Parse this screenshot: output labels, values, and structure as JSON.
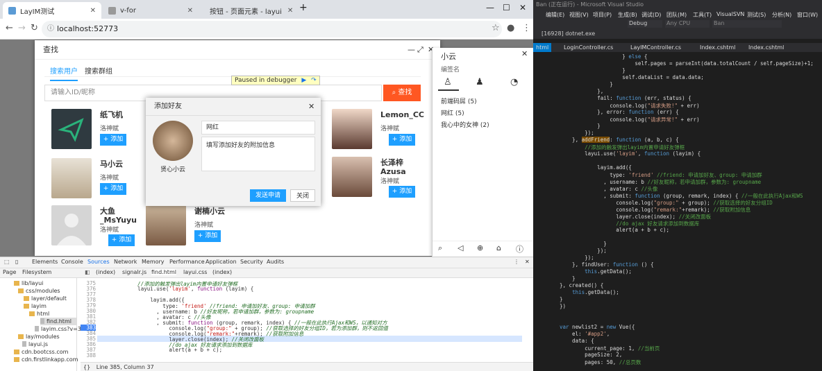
{
  "browser": {
    "tabs": [
      {
        "label": "LayIM测试",
        "icon_color": "#5b9bd5"
      },
      {
        "label": "v-for",
        "icon_color": "#999999"
      },
      {
        "label": "按钮 - 页面元素 - layui",
        "icon_color": "#393d49"
      }
    ],
    "new_tab": "+",
    "url": "localhost:52773",
    "debugger_label": "Paused in debugger"
  },
  "find_dialog": {
    "title": "查找",
    "tabs": [
      "搜索用户",
      "搜索群组"
    ],
    "search_placeholder": "请输入ID/昵称",
    "search_button": "查找",
    "add_label": "+ 添加",
    "users": [
      {
        "name": "纸飞机",
        "sign": "洛神赋"
      },
      {
        "name": "马小云",
        "sign": "洛神赋"
      },
      {
        "name": "大鱼_MsYuyu",
        "sign": "洛神赋"
      },
      {
        "name": "谢楠小云",
        "sign": "洛神赋"
      },
      {
        "name": "Lemon_CC",
        "sign": "洛神赋"
      },
      {
        "name": "长泽梓Azusa",
        "sign": "洛神赋"
      }
    ]
  },
  "add_friend": {
    "title": "添加好友",
    "avatar_name": "贤心小云",
    "remark_value": "网红",
    "remark_text": "填写添加好友的附加信息",
    "send_button": "发送申请",
    "close_button": "关闭"
  },
  "chat_panel": {
    "title": "小云",
    "subtitle": "编签名",
    "groups": [
      "前端码屌 (5)",
      "网红 (5)",
      "我心中的女神 (2)"
    ]
  },
  "devtools": {
    "tabs": [
      "Elements",
      "Console",
      "Sources",
      "Network",
      "Memory",
      "Performance",
      "Application",
      "Security",
      "Audits"
    ],
    "source_tabs": [
      "(index)",
      "signalr.js",
      "find.html",
      "layui.css",
      "(index)"
    ],
    "left_tabs": [
      "Page",
      "Filesystem"
    ],
    "tree": [
      "lib/layui",
      "css/modules",
      "layer/default",
      "layim",
      "html",
      "find.html",
      "layim.css?v=3",
      "lay/modules",
      "layui.js",
      "cdn.bootcss.com",
      "cdn.firstlinkapp.com"
    ],
    "line_numbers": [
      "375",
      "376",
      "377",
      "378",
      "379",
      "380",
      "381",
      "382",
      "383",
      "384",
      "385",
      "386",
      "387",
      "388"
    ],
    "status": "Line 385, Column 37"
  },
  "vs": {
    "title": "Ban (正在运行) - Microsoft Visual Studio",
    "menu": [
      "编辑(E)",
      "视图(V)",
      "项目(P)",
      "生成(B)",
      "调试(D)",
      "团队(M)",
      "工具(T)",
      "VisualSVN",
      "测试(S)",
      "分析(N)",
      "窗口(W)"
    ],
    "process": "[16928] dotnet.exe",
    "config": "Debug",
    "platform": "Any CPU",
    "project": "Ban",
    "tabs": [
      "html",
      "LoginController.cs",
      "LayIMController.cs",
      "Index.cshtml",
      "Index.cshtml"
    ]
  },
  "colors": {
    "accent": "#1e9fff",
    "danger": "#ff5722"
  }
}
